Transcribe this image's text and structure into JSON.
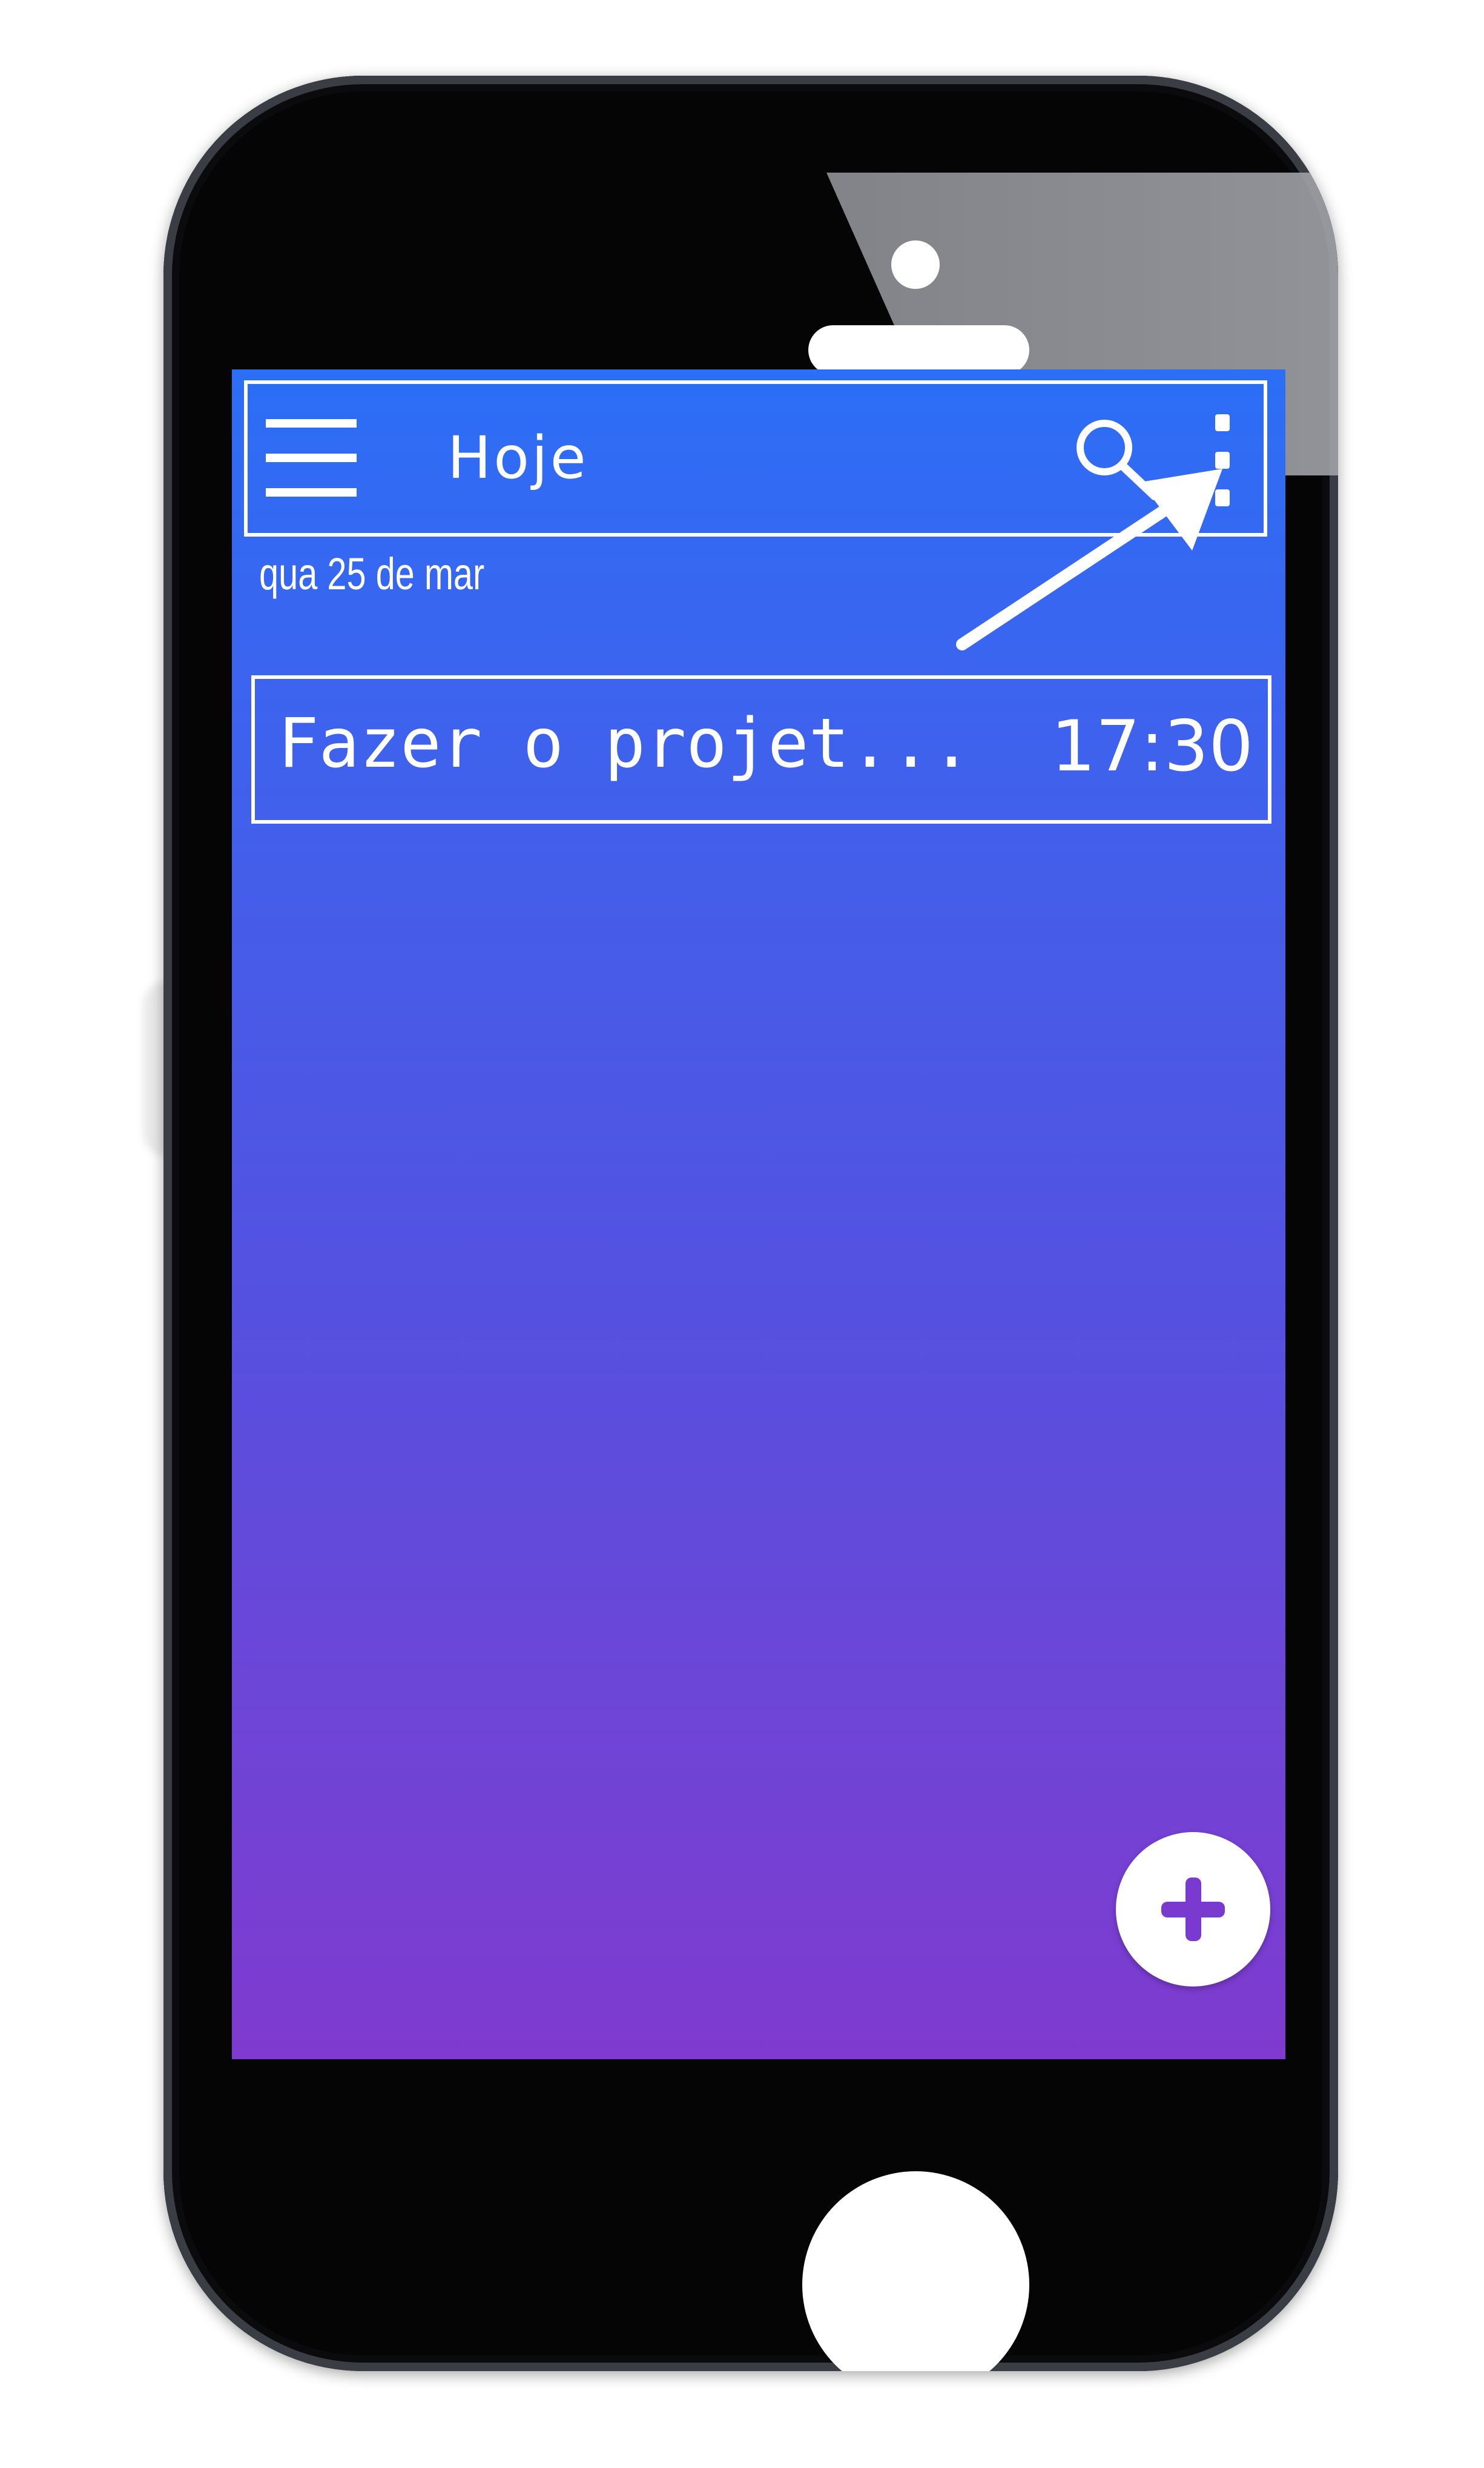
{
  "appbar": {
    "title": "Hoje",
    "menu_icon": "hamburger-menu-icon",
    "search_icon": "search-icon",
    "more_icon": "more-vertical-icon"
  },
  "date_label": "qua 25 de mar",
  "tasks": [
    {
      "title": "Fazer o projet...",
      "time": "17:30"
    }
  ],
  "fab": {
    "icon": "plus-icon"
  },
  "annotation": {
    "icon": "arrow-annotation-icon"
  },
  "colors": {
    "gradient_top": "#2c6ef6",
    "gradient_bottom": "#7f3acf",
    "accent": "#7a3acf",
    "phone_body": "#050506"
  }
}
